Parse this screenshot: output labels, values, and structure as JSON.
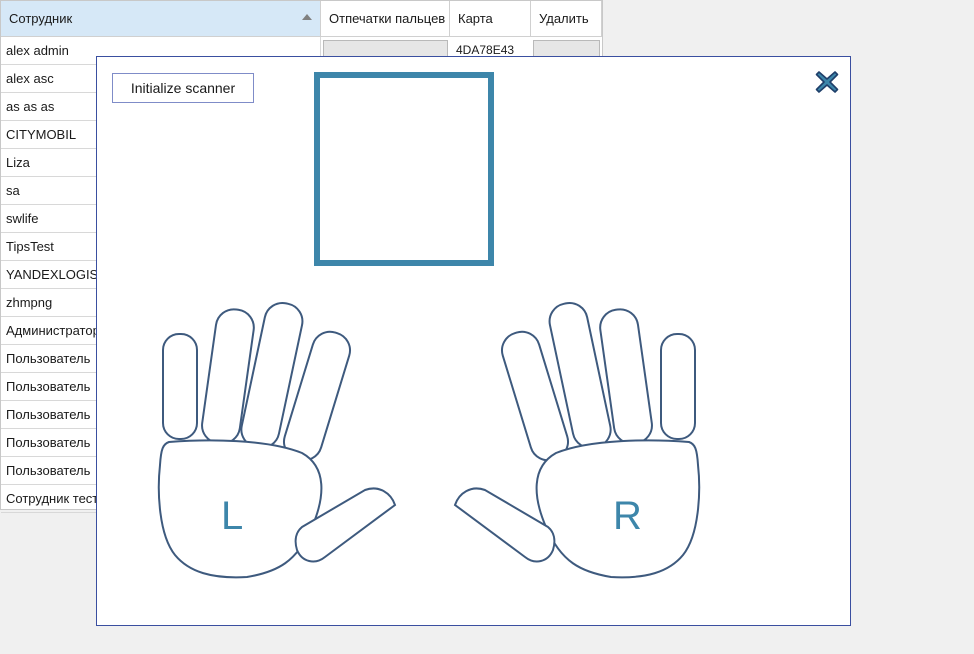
{
  "grid": {
    "columns": {
      "employee": "Сотрудник",
      "fingerprints": "Отпечатки пальцев",
      "card": "Карта",
      "delete": "Удалить"
    },
    "rows": [
      {
        "name": "alex admin",
        "card": "4DA78E43"
      },
      {
        "name": "alex asc",
        "card": ""
      },
      {
        "name": "as as as",
        "card": ""
      },
      {
        "name": "CITYMOBIL",
        "card": ""
      },
      {
        "name": "Liza",
        "card": ""
      },
      {
        "name": "sa",
        "card": ""
      },
      {
        "name": "swlife",
        "card": ""
      },
      {
        "name": "TipsTest",
        "card": ""
      },
      {
        "name": "YANDEXLOGISTIC",
        "card": ""
      },
      {
        "name": "zhmpng",
        "card": ""
      },
      {
        "name": "Администратор",
        "card": ""
      },
      {
        "name": "Пользователь",
        "card": ""
      },
      {
        "name": "Пользователь",
        "card": ""
      },
      {
        "name": "Пользователь",
        "card": ""
      },
      {
        "name": "Пользователь",
        "card": ""
      },
      {
        "name": "Пользователь",
        "card": ""
      },
      {
        "name": "Сотрудник тест",
        "card": ""
      }
    ]
  },
  "modal": {
    "init_button": "Initialize scanner",
    "close_icon": "close-x-icon",
    "left_hand_label": "L",
    "right_hand_label": "R"
  },
  "colors": {
    "accent": "#3d86aa",
    "outline": "#3e5a7e",
    "modal_border": "#3a4fa0",
    "header_selected": "#d6e8f7"
  }
}
